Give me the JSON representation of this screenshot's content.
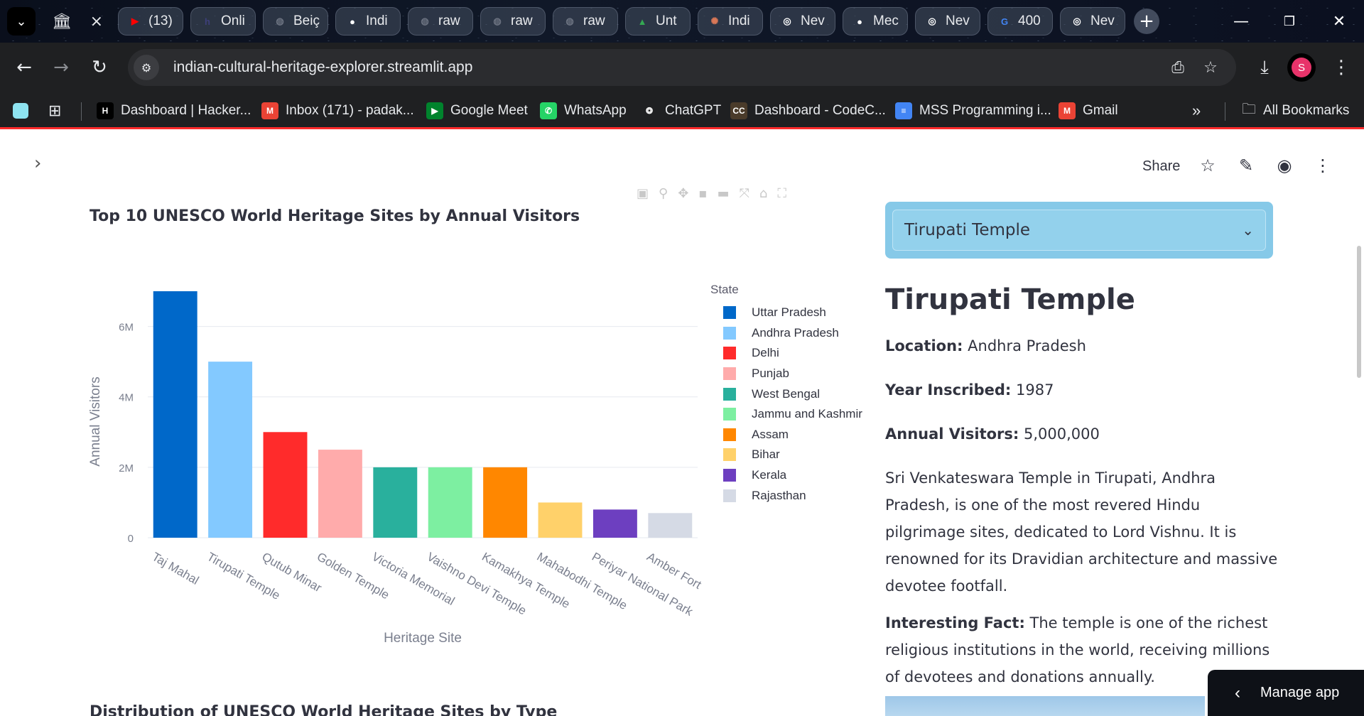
{
  "browser": {
    "active_tab": {
      "close": "×"
    },
    "tabs": [
      {
        "label": "(13)",
        "icon": "youtube-icon",
        "color": "#ff0000"
      },
      {
        "label": "Onli",
        "icon": "h-icon",
        "color": "#3d3f7a"
      },
      {
        "label": "Beiç",
        "icon": "globe-icon",
        "color": "#6b7280"
      },
      {
        "label": "Indi",
        "icon": "github-icon",
        "color": "#ffffff"
      },
      {
        "label": "raw",
        "icon": "globe-icon",
        "color": "#6b7280"
      },
      {
        "label": "raw",
        "icon": "globe-icon",
        "color": "#6b7280"
      },
      {
        "label": "raw",
        "icon": "globe-icon",
        "color": "#6b7280"
      },
      {
        "label": "Unt",
        "icon": "drive-icon",
        "color": "#34a853"
      },
      {
        "label": "Indi",
        "icon": "claude-icon",
        "color": "#d97757"
      },
      {
        "label": "Nev",
        "icon": "chrome-icon",
        "color": "#ffffff"
      },
      {
        "label": "Mec",
        "icon": "github-icon",
        "color": "#ffffff"
      },
      {
        "label": "Nev",
        "icon": "chrome-icon",
        "color": "#ffffff"
      },
      {
        "label": "400",
        "icon": "google-icon",
        "color": "#4285f4"
      },
      {
        "label": "Nev",
        "icon": "chrome-icon",
        "color": "#ffffff"
      }
    ],
    "url": "indian-cultural-heritage-explorer.streamlit.app",
    "profile_initial": "S",
    "bookmarks": [
      {
        "label": "Dashboard | Hacker...",
        "icon": "hackerrank-icon",
        "badge": "H",
        "color": "#000000"
      },
      {
        "label": "Inbox (171) - padak...",
        "icon": "gmail-icon",
        "badge": "M",
        "color": "#ea4335"
      },
      {
        "label": "Google Meet",
        "icon": "meet-icon",
        "badge": "▶",
        "color": "#00832d"
      },
      {
        "label": "WhatsApp",
        "icon": "whatsapp-icon",
        "badge": "✆",
        "color": "#25d366"
      },
      {
        "label": "ChatGPT",
        "icon": "chatgpt-icon",
        "badge": "❂",
        "color": "#1f2022"
      },
      {
        "label": "Dashboard - CodeC...",
        "icon": "codechef-icon",
        "badge": "CC",
        "color": "#4a3b2a"
      },
      {
        "label": "MSS Programming i...",
        "icon": "docs-icon",
        "badge": "≡",
        "color": "#4285f4"
      },
      {
        "label": "Gmail",
        "icon": "gmail-icon",
        "badge": "M",
        "color": "#ea4335"
      }
    ],
    "more": "»",
    "all_bookmarks": "All Bookmarks"
  },
  "app_header": {
    "share": "Share"
  },
  "chart_data": {
    "type": "bar",
    "title": "Top 10 UNESCO World Heritage Sites by Annual Visitors",
    "xlabel": "Heritage Site",
    "ylabel": "Annual Visitors",
    "ylim": [
      0,
      7000000
    ],
    "yticks": [
      0,
      2000000,
      4000000,
      6000000
    ],
    "ytick_labels": [
      "0",
      "2M",
      "4M",
      "6M"
    ],
    "grid": true,
    "legend_title": "State",
    "legend_position": "right",
    "categories": [
      "Taj Mahal",
      "Tirupati Temple",
      "Qutub Minar",
      "Golden Temple",
      "Victoria Memorial",
      "Vaishno Devi Temple",
      "Kamakhya Temple",
      "Mahabodhi Temple",
      "Periyar National Park",
      "Amber Fort"
    ],
    "values": [
      7000000,
      5000000,
      3000000,
      2500000,
      2000000,
      2000000,
      2000000,
      1000000,
      800000,
      700000
    ],
    "series": [
      {
        "name": "Uttar Pradesh",
        "color": "#0068c9"
      },
      {
        "name": "Andhra Pradesh",
        "color": "#83c9ff"
      },
      {
        "name": "Delhi",
        "color": "#ff2b2b"
      },
      {
        "name": "Punjab",
        "color": "#ffabab"
      },
      {
        "name": "West Bengal",
        "color": "#29b09d"
      },
      {
        "name": "Jammu and Kashmir",
        "color": "#7defa1"
      },
      {
        "name": "Assam",
        "color": "#ff8700"
      },
      {
        "name": "Bihar",
        "color": "#ffd16a"
      },
      {
        "name": "Kerala",
        "color": "#6d3fc0"
      },
      {
        "name": "Rajasthan",
        "color": "#d5dae5"
      }
    ]
  },
  "next_section_title": "Distribution of UNESCO World Heritage Sites by Type",
  "detail": {
    "select_value": "Tirupati Temple",
    "title": "Tirupati Temple",
    "location_label": "Location:",
    "location_value": "Andhra Pradesh",
    "year_label": "Year Inscribed:",
    "year_value": "1987",
    "visitors_label": "Annual Visitors:",
    "visitors_value": "5,000,000",
    "description": "Sri Venkateswara Temple in Tirupati, Andhra Pradesh, is one of the most revered Hindu pilgrimage sites, dedicated to Lord Vishnu. It is renowned for its Dravidian architecture and massive devotee footfall.",
    "fact_label": "Interesting Fact:",
    "fact_value": "The temple is one of the richest religious institutions in the world, receiving millions of devotees and donations annually."
  },
  "manage_app": "Manage app"
}
